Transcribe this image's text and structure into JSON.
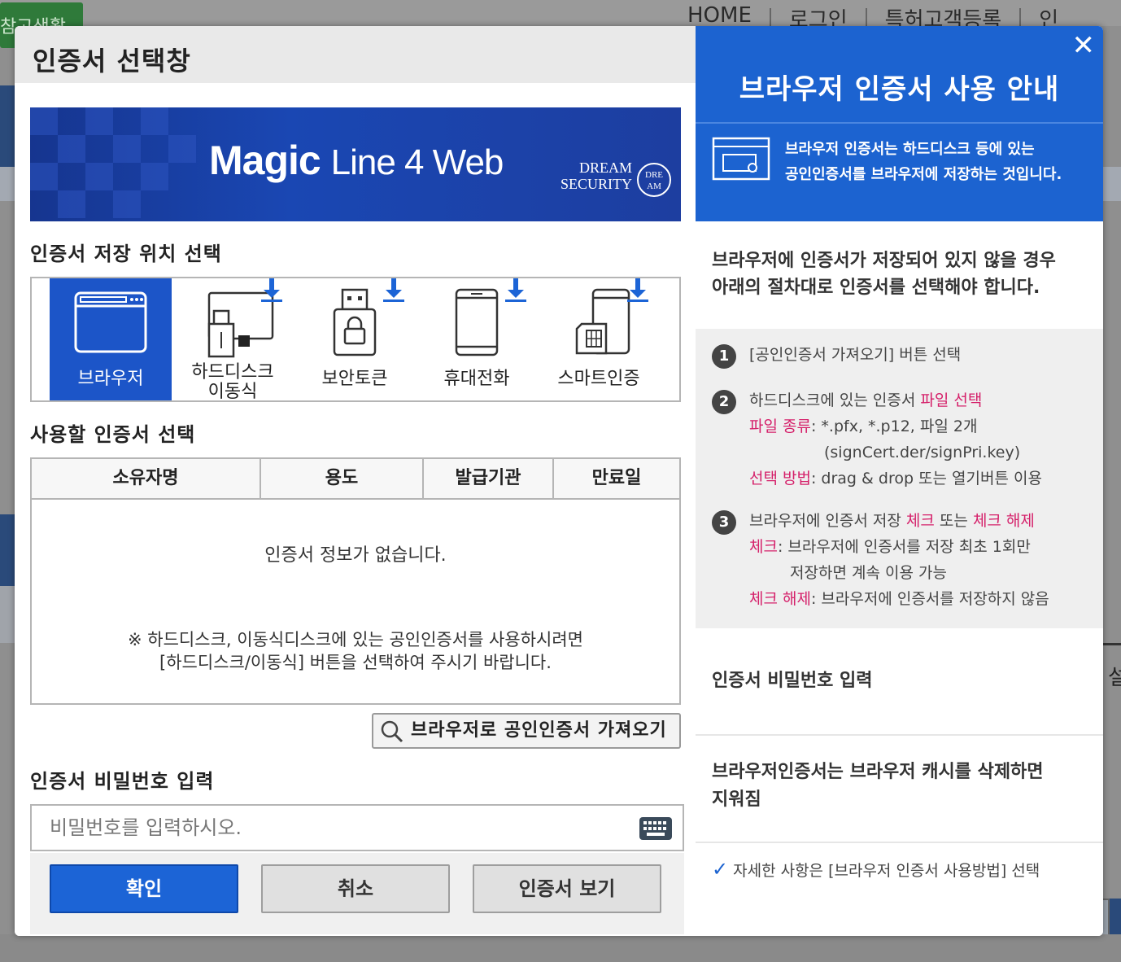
{
  "background": {
    "green_button": "참고생활",
    "nav": [
      "HOME",
      "로그인",
      "특허고객등록",
      "인"
    ],
    "right_text": "설"
  },
  "dialog": {
    "title": "인증서 선택창",
    "banner": {
      "title_bold": "Magic",
      "title_rest": "Line 4 Web",
      "logo_line1": "DREAM",
      "logo_line2": "SECURITY",
      "logo_badge": "DRE AM"
    },
    "storage_section_label": "인증서 저장 위치 선택",
    "storage_items": [
      {
        "label": "브라우저",
        "icon": "browser-icon",
        "active": true
      },
      {
        "label": "하드디스크 이동식",
        "icon": "harddisk-removable-icon",
        "active": false
      },
      {
        "label": "보안토큰",
        "icon": "security-token-icon",
        "active": false
      },
      {
        "label": "휴대전화",
        "icon": "mobile-phone-icon",
        "active": false
      },
      {
        "label": "스마트인증",
        "icon": "smart-cert-icon",
        "active": false
      }
    ],
    "storage_labels": {
      "browser": "브라우저",
      "harddisk_line1": "하드디스크",
      "harddisk_line2": "이동식",
      "token": "보안토큰",
      "phone": "휴대전화",
      "smart": "스마트인증"
    },
    "cert_section_label": "사용할 인증서 선택",
    "cert_table": {
      "columns": [
        "소유자명",
        "용도",
        "발급기관",
        "만료일"
      ],
      "empty_message": "인증서 정보가 없습니다.",
      "note_line1": "※ 하드디스크, 이동식디스크에 있는 공인인증서를 사용하시려면",
      "note_line2": "[하드디스크/이동식] 버튼을 선택하여 주시기 바랍니다."
    },
    "import_button": "브라우저로 공인인증서 가져오기",
    "password_section_label": "인증서 비밀번호 입력",
    "password_placeholder": "비밀번호를 입력하시오.",
    "buttons": {
      "confirm": "확인",
      "cancel": "취소",
      "view": "인증서 보기"
    },
    "accent_color": "#1c64d6"
  },
  "guide": {
    "close": "✕",
    "title": "브라우저 인증서 사용 안내",
    "desc_line1": "브라우저 인증서는 하드디스크 등에 있는",
    "desc_line2": "공인인증서를 브라우저에 저장하는 것입니다.",
    "intro_line1": "브라우저에 인증서가 저장되어 있지 않을 경우",
    "intro_line2": "아래의 절차대로 인증서를 선택해야 합니다.",
    "step1": {
      "num": "1",
      "text": "[공인인증서 가져오기] 버튼 선택"
    },
    "step2": {
      "num": "2",
      "line1_a": "하드디스크에 있는 인증서 ",
      "line1_b": "파일 선택",
      "line2_a": "파일 종류",
      "line2_b": ": *.pfx, *.p12, 파일 2개",
      "line3": "(signCert.der/signPri.key)",
      "line4_a": "선택 방법",
      "line4_b": ": drag & drop 또는 열기버튼 이용"
    },
    "step3": {
      "num": "3",
      "line1_a": "브라우저에 인증서 저장 ",
      "line1_b": "체크",
      "line1_c": " 또는 ",
      "line1_d": "체크 해제",
      "line2_a": "체크",
      "line2_b": ": 브라우저에 인증서를 저장 최초 1회만",
      "line3": "저장하면 계속 이용 가능",
      "line4_a": "체크 해제",
      "line4_b": ": 브라우저에 인증서를 저장하지 않음"
    },
    "password_label": "인증서 비밀번호 입력",
    "cache_line1": "브라우저인증서는 브라우저 캐시를 삭제하면",
    "cache_line2": "지워짐",
    "detail_check": "✓",
    "detail_text": "자세한 사항은 [브라우저 인증서 사용방법] 선택",
    "highlight_color": "#d5206a"
  }
}
